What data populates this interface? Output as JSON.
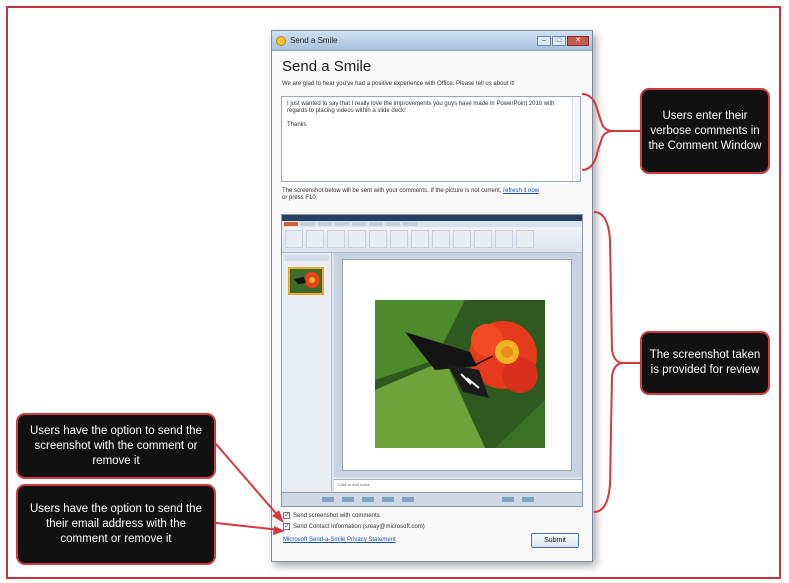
{
  "window": {
    "title": "Send a Smile",
    "heading": "Send a Smile",
    "intro": "We are glad to hear you've had a positive experience with Office.  Please tell us about it!",
    "comment_lines": [
      "I just wanted to say that I really love the improvements you guys have made in PowerPoint 2010 with regards to placing videos within a slide deck!",
      "Thanks"
    ],
    "screenshot_note": "The screenshot below will be sent with your comments.  If the picture is not current,",
    "refresh_link": "refresh it now",
    "screenshot_note_tail": "or press F10.",
    "notes_placeholder": "Click to add notes",
    "send_screenshot_label": "Send screenshot with comments",
    "send_contact_label": "Send Contact Information (sreay@microsoft.com)",
    "privacy_link": "Microsoft Send-a-Smile Privacy Statement",
    "submit_label": "Submit"
  },
  "callouts": {
    "comment_window": "Users enter their verbose comments in the Comment Window",
    "screenshot_review": "The screenshot taken is provided for review",
    "screenshot_option": "Users have the option to send the screenshot with the comment or remove it",
    "email_option": "Users have the option to send the their email address with the comment or remove it"
  },
  "colors": {
    "frame": "#c9323b",
    "callout_bg": "#111111",
    "callout_border": "#d23a40",
    "link": "#1c4fb5"
  }
}
